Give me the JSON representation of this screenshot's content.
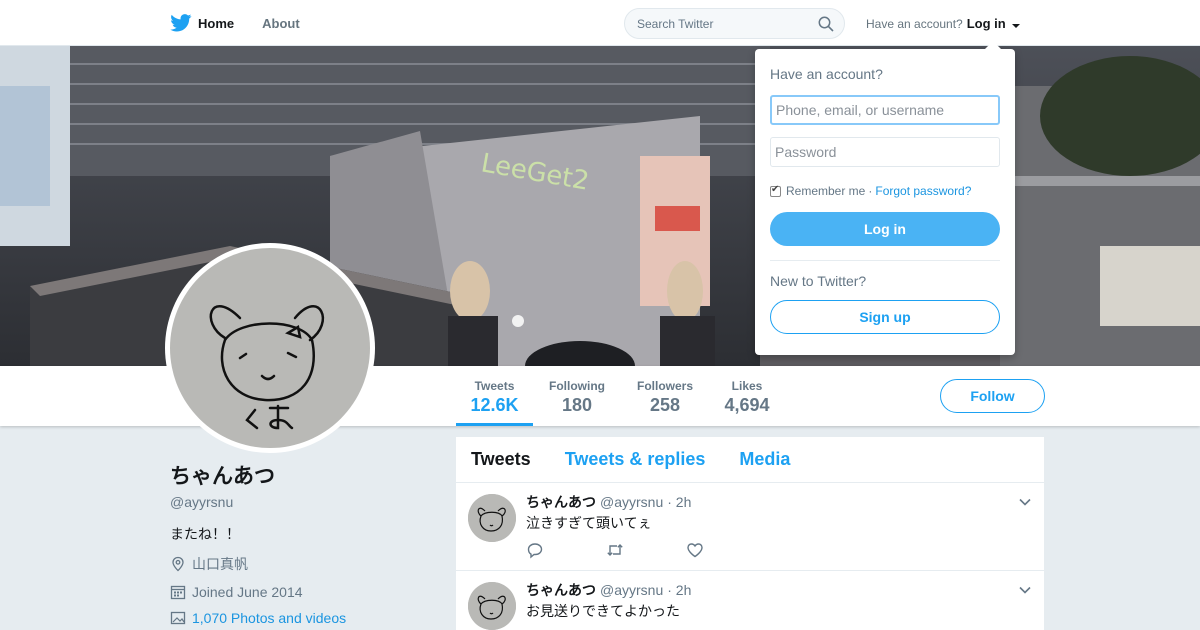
{
  "colors": {
    "brand": "#1da1f2",
    "link": "#1b95e0",
    "background": "#e6ecf0"
  },
  "nav": {
    "home_icon": "twitter-bird-icon",
    "home_label": "Home",
    "about_label": "About",
    "search_placeholder": "Search Twitter",
    "search_icon": "search-icon",
    "have_account": "Have an account?",
    "login_label": "Log in"
  },
  "login_dropdown": {
    "title": "Have an account?",
    "username_placeholder": "Phone, email, or username",
    "password_placeholder": "Password",
    "remember_label": "Remember me",
    "separator": "·",
    "forgot_label": "Forgot password?",
    "login_button": "Log in",
    "new_to_twitter": "New to Twitter?",
    "signup_button": "Sign up"
  },
  "profile_nav": {
    "stats": [
      {
        "label": "Tweets",
        "value": "12.6K"
      },
      {
        "label": "Following",
        "value": "180"
      },
      {
        "label": "Followers",
        "value": "258"
      },
      {
        "label": "Likes",
        "value": "4,694"
      }
    ],
    "follow_button": "Follow"
  },
  "profile": {
    "name": "ちゃんあつ",
    "handle": "@ayyrsnu",
    "bio": "またね！！",
    "location": "山口真帆",
    "location_icon": "location-pin-icon",
    "joined": "Joined June 2014",
    "joined_icon": "calendar-icon",
    "photos": "1,070 Photos and videos",
    "photos_icon": "photo-icon"
  },
  "timeline": {
    "tabs": [
      "Tweets",
      "Tweets & replies",
      "Media"
    ],
    "tweets": [
      {
        "name": "ちゃんあつ",
        "handle": "@ayyrsnu",
        "time": "· 2h",
        "text": "泣きすぎて頭いてぇ"
      },
      {
        "name": "ちゃんあつ",
        "handle": "@ayyrsnu",
        "time": "· 2h",
        "text": "お見送りできてよかった"
      }
    ]
  }
}
